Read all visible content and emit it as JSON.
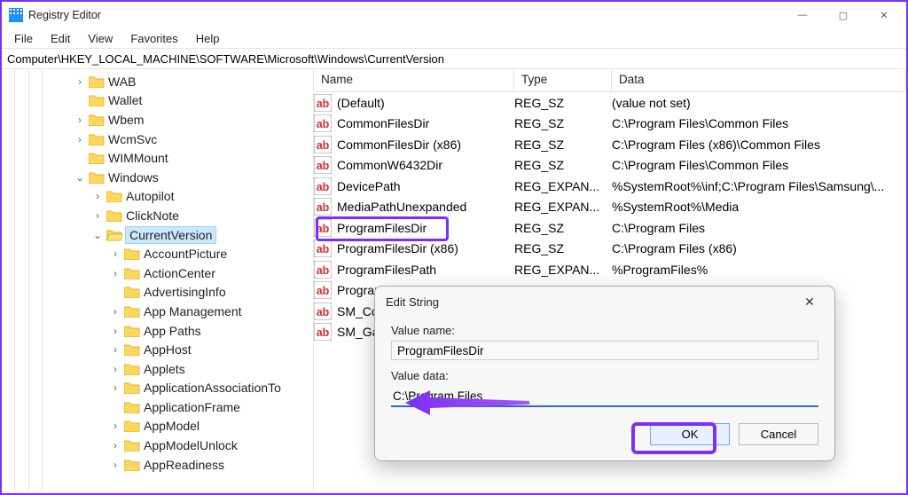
{
  "window": {
    "title": "Registry Editor",
    "controls": {
      "min": "—",
      "max": "▢",
      "close": "✕"
    }
  },
  "menu": {
    "file": "File",
    "edit": "Edit",
    "view": "View",
    "favorites": "Favorites",
    "help": "Help"
  },
  "address": "Computer\\HKEY_LOCAL_MACHINE\\SOFTWARE\\Microsoft\\Windows\\CurrentVersion",
  "tree": {
    "items": [
      {
        "indent": 80,
        "exp": ">",
        "label": "WAB"
      },
      {
        "indent": 80,
        "exp": "",
        "label": "Wallet"
      },
      {
        "indent": 80,
        "exp": ">",
        "label": "Wbem"
      },
      {
        "indent": 80,
        "exp": ">",
        "label": "WcmSvc"
      },
      {
        "indent": 80,
        "exp": "",
        "label": "WIMMount"
      },
      {
        "indent": 80,
        "exp": "v",
        "label": "Windows"
      },
      {
        "indent": 100,
        "exp": ">",
        "label": "Autopilot"
      },
      {
        "indent": 100,
        "exp": ">",
        "label": "ClickNote"
      },
      {
        "indent": 100,
        "exp": "v",
        "label": "CurrentVersion",
        "selected": true
      },
      {
        "indent": 120,
        "exp": ">",
        "label": "AccountPicture"
      },
      {
        "indent": 120,
        "exp": ">",
        "label": "ActionCenter"
      },
      {
        "indent": 120,
        "exp": "",
        "label": "AdvertisingInfo"
      },
      {
        "indent": 120,
        "exp": ">",
        "label": "App Management"
      },
      {
        "indent": 120,
        "exp": ">",
        "label": "App Paths"
      },
      {
        "indent": 120,
        "exp": ">",
        "label": "AppHost"
      },
      {
        "indent": 120,
        "exp": ">",
        "label": "Applets"
      },
      {
        "indent": 120,
        "exp": ">",
        "label": "ApplicationAssociationTo"
      },
      {
        "indent": 120,
        "exp": "",
        "label": "ApplicationFrame"
      },
      {
        "indent": 120,
        "exp": ">",
        "label": "AppModel"
      },
      {
        "indent": 120,
        "exp": ">",
        "label": "AppModelUnlock"
      },
      {
        "indent": 120,
        "exp": ">",
        "label": "AppReadiness"
      }
    ]
  },
  "list": {
    "headers": {
      "name": "Name",
      "type": "Type",
      "data": "Data"
    },
    "rows": [
      {
        "name": "(Default)",
        "type": "REG_SZ",
        "data": "(value not set)"
      },
      {
        "name": "CommonFilesDir",
        "type": "REG_SZ",
        "data": "C:\\Program Files\\Common Files"
      },
      {
        "name": "CommonFilesDir (x86)",
        "type": "REG_SZ",
        "data": "C:\\Program Files (x86)\\Common Files"
      },
      {
        "name": "CommonW6432Dir",
        "type": "REG_SZ",
        "data": "C:\\Program Files\\Common Files"
      },
      {
        "name": "DevicePath",
        "type": "REG_EXPAN...",
        "data": "%SystemRoot%\\inf;C:\\Program Files\\Samsung\\..."
      },
      {
        "name": "MediaPathUnexpanded",
        "type": "REG_EXPAN...",
        "data": "%SystemRoot%\\Media"
      },
      {
        "name": "ProgramFilesDir",
        "type": "REG_SZ",
        "data": "C:\\Program Files",
        "highlighted": true
      },
      {
        "name": "ProgramFilesDir (x86)",
        "type": "REG_SZ",
        "data": "C:\\Program Files (x86)"
      },
      {
        "name": "ProgramFilesPath",
        "type": "REG_EXPAN...",
        "data": "%ProgramFiles%"
      },
      {
        "name": "Program",
        "type": "",
        "data": ""
      },
      {
        "name": "SM_Co",
        "type": "",
        "data": ""
      },
      {
        "name": "SM_Ga",
        "type": "",
        "data": ""
      }
    ]
  },
  "dialog": {
    "title": "Edit String",
    "value_name_label": "Value name:",
    "value_name": "ProgramFilesDir",
    "value_data_label": "Value data:",
    "value_data": "C:\\Program Files",
    "ok": "OK",
    "cancel": "Cancel",
    "close": "✕"
  }
}
